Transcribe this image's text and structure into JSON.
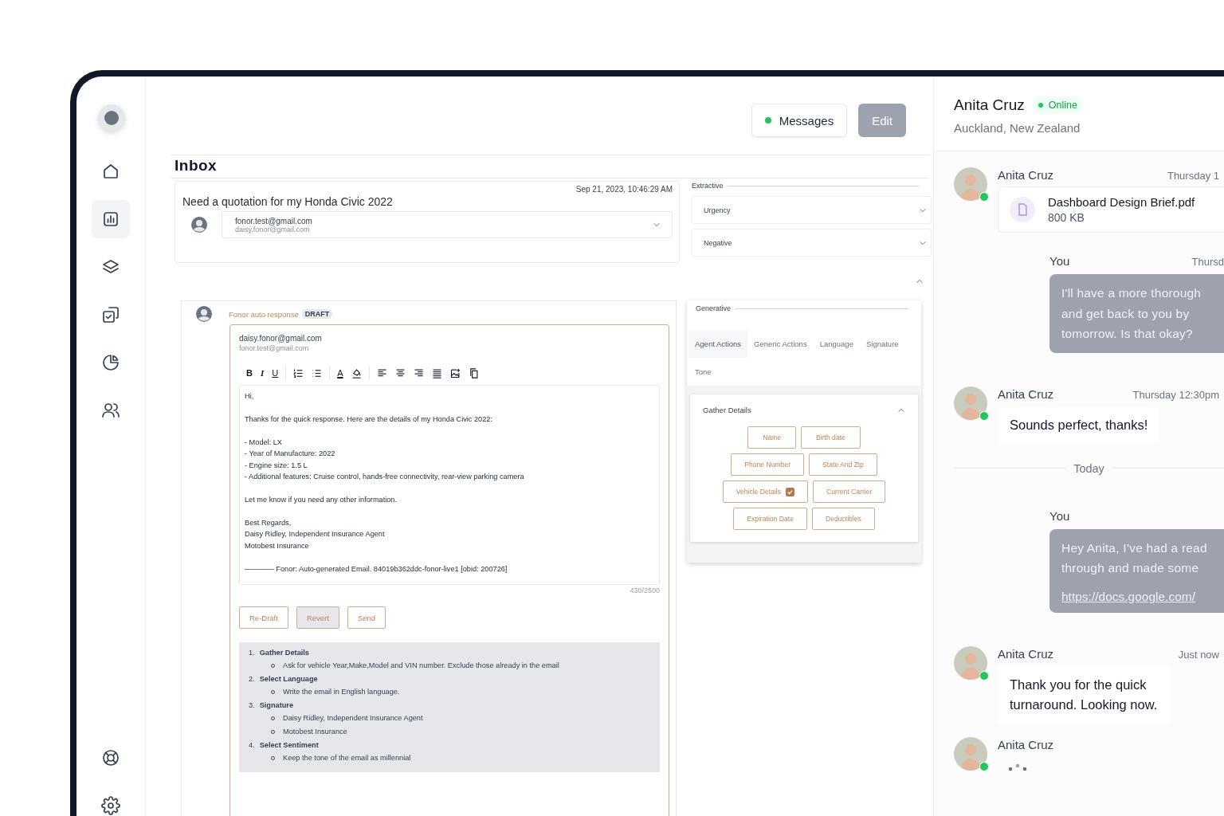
{
  "sidebar": {
    "items": [
      {
        "kind": "home",
        "selected": false
      },
      {
        "kind": "chart",
        "selected": true
      },
      {
        "kind": "layers",
        "selected": false
      },
      {
        "kind": "tasks",
        "selected": false
      },
      {
        "kind": "pie",
        "selected": false
      },
      {
        "kind": "users",
        "selected": false
      }
    ],
    "bottom_items": [
      {
        "kind": "support",
        "selected": false
      },
      {
        "kind": "settings",
        "selected": false
      }
    ]
  },
  "header": {
    "buttons": [
      {
        "label": "Messages",
        "kind": "status"
      },
      {
        "label": "Edit",
        "kind": "filled"
      }
    ]
  },
  "inbox": {
    "title": "Inbox"
  },
  "email": {
    "timestamp": "Sep 21, 2023, 10:46:29 AM",
    "subject": "Need a quotation for my Honda Civic 2022",
    "from": "fonor.test@gmail.com",
    "to": "daisy.fonor@gmail.com"
  },
  "extractive": {
    "legend": "Extractive",
    "selects": [
      {
        "value": "Urgency"
      },
      {
        "value": "Negative"
      }
    ]
  },
  "draft": {
    "label": "Fonor auto response",
    "badge": "DRAFT",
    "from": "daisy.fonor@gmail.com",
    "to": "fonor.test@gmail.com",
    "toolbar": [
      {
        "kind": "bold",
        "label": "B"
      },
      {
        "kind": "italic",
        "label": "I"
      },
      {
        "kind": "underline",
        "label": "U"
      },
      {
        "kind": "sep"
      },
      {
        "kind": "ordered-list"
      },
      {
        "kind": "bullet-list"
      },
      {
        "kind": "sep"
      },
      {
        "kind": "text-color",
        "label": "A"
      },
      {
        "kind": "fill-color"
      },
      {
        "kind": "sep"
      },
      {
        "kind": "align-left"
      },
      {
        "kind": "align-center"
      },
      {
        "kind": "align-right"
      },
      {
        "kind": "justify"
      },
      {
        "kind": "image"
      },
      {
        "kind": "copy"
      }
    ],
    "body": "Hi,\n\nThanks for the quick response. Here are the details of my Honda Civic 2022:\n\n- Model: LX\n- Year of Manufacture: 2022\n- Engine size: 1.5 L\n- Additional features: Cruise control, hands-free connectivity, rear-view parking camera\n\nLet me know if you need any other information.\n\nBest Regards,\nDaisy Ridley, Independent Insurance Agent\nMotobest Insurance\n\n———— Fonor: Auto-generated Email. 84019b362ddc-fonor-live1 [obid: 200726]",
    "counter": "430/2500",
    "buttons": [
      {
        "label": "Re-Draft",
        "selected": false
      },
      {
        "label": "Revert",
        "selected": true
      },
      {
        "label": "Send",
        "selected": false
      }
    ],
    "instructions": [
      {
        "number": "1.",
        "title": "Gather Details",
        "items": [
          "Ask for vehicle Year,Make,Model and VIN number. Exclude those already in the email"
        ]
      },
      {
        "number": "2.",
        "title": "Select Language",
        "items": [
          "Write the email in English language."
        ]
      },
      {
        "number": "3.",
        "title": "Signature",
        "items": [
          "Daisy Ridley, Independent Insurance Agent",
          "Motobest Insurance"
        ]
      },
      {
        "number": "4.",
        "title": "Select Sentiment",
        "items": [
          "Keep the tone of the email as millennial"
        ]
      }
    ]
  },
  "generative": {
    "legend": "Generative",
    "tabs": [
      {
        "label": "Agent Actions",
        "selected": true
      },
      {
        "label": "Generic Actions",
        "selected": false
      },
      {
        "label": "Language",
        "selected": false
      },
      {
        "label": "Signature",
        "selected": false
      },
      {
        "label": "Tone",
        "selected": false
      }
    ],
    "section": {
      "title": "Gather Details",
      "expanded": true,
      "chip_rows": [
        [
          {
            "label": "Name",
            "checked": false
          },
          {
            "label": "Birth date",
            "checked": false
          }
        ],
        [
          {
            "label": "Phone Number",
            "checked": false
          },
          {
            "label": "State And Zip",
            "checked": false
          }
        ],
        [
          {
            "label": "Vehicle Details",
            "checked": true
          },
          {
            "label": "Current Carrier",
            "checked": false
          }
        ],
        [
          {
            "label": "Expiration Date",
            "checked": false
          },
          {
            "label": "Deductibles",
            "checked": false
          }
        ]
      ]
    }
  },
  "chat": {
    "contact": {
      "name": "Anita Cruz",
      "status": "Online",
      "location": "Auckland, New Zealand"
    },
    "messages": [
      {
        "kind": "file",
        "author": "Anita Cruz",
        "time": "Thursday 1",
        "online": true,
        "file_name": "Dashboard Design Brief.pdf",
        "file_size": "800 KB"
      },
      {
        "kind": "outgoing",
        "author": "You",
        "time": "Thursd",
        "text": "I'll have a more thorough\nand get back to you by\ntomorrow. Is that okay?"
      },
      {
        "kind": "incoming",
        "author": "Anita Cruz",
        "time": "Thursday 12:30pm",
        "online": true,
        "text": "Sounds perfect, thanks!"
      },
      {
        "kind": "divider",
        "label": "Today"
      },
      {
        "kind": "outgoing",
        "author": "You",
        "text": "Hey Anita, I’ve had a read\nthrough and made some",
        "link": "https://docs.google.com/"
      },
      {
        "kind": "incoming",
        "author": "Anita Cruz",
        "time": "Just now",
        "online": true,
        "text": "Thank you for the quick\nturnaround. Looking now."
      },
      {
        "kind": "typing",
        "author": "Anita Cruz",
        "online": true
      }
    ]
  }
}
